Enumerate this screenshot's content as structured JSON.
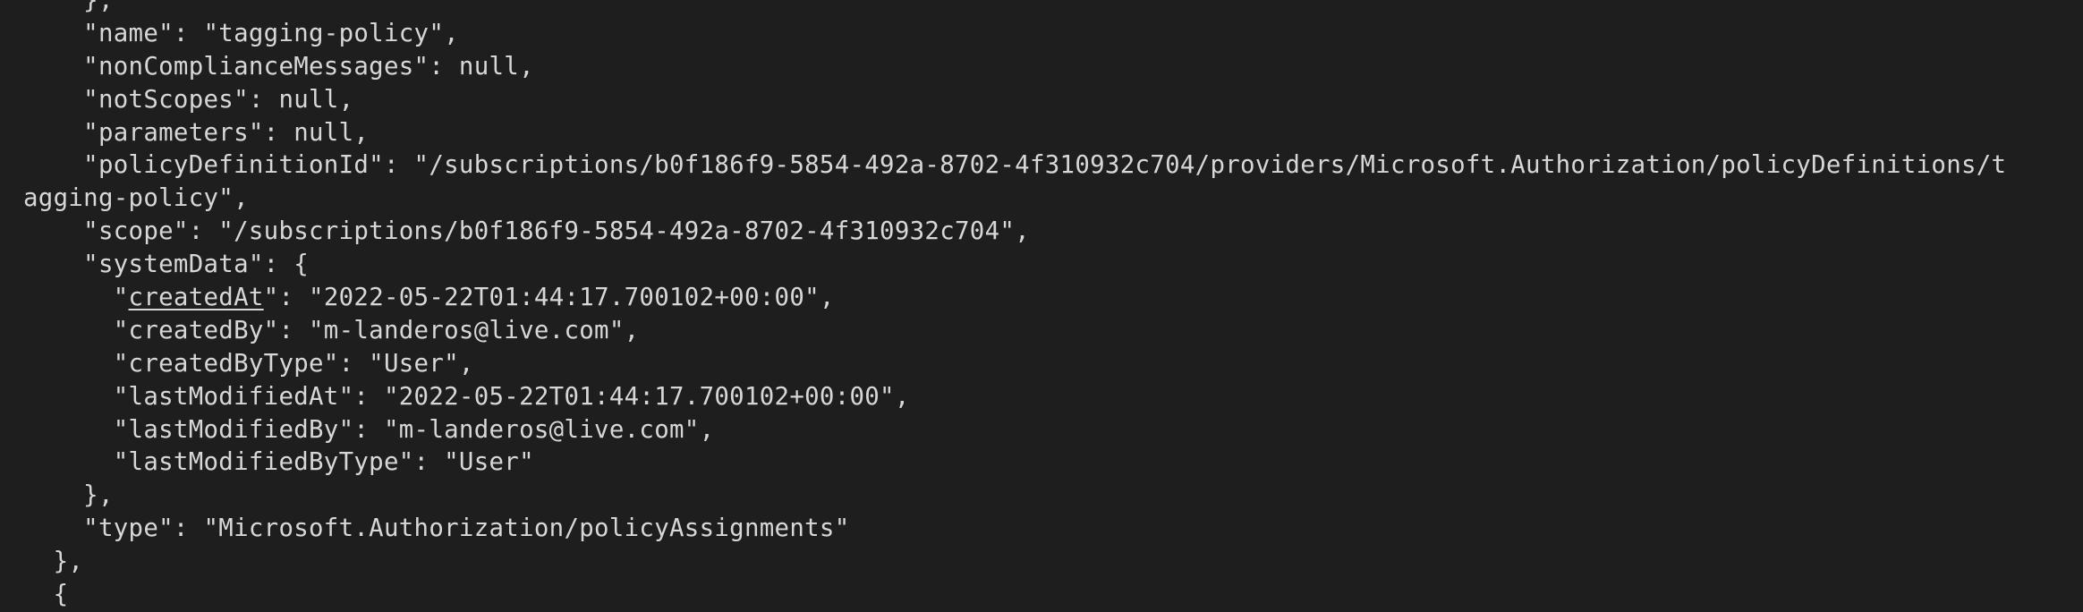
{
  "terminal": {
    "lines": [
      "    },",
      "    \"name\": \"tagging-policy\",",
      "    \"nonComplianceMessages\": null,",
      "    \"notScopes\": null,",
      "    \"parameters\": null,",
      "    \"policyDefinitionId\": \"/subscriptions/b0f186f9-5854-492a-8702-4f310932c704/providers/Microsoft.Authorization/policyDefinitions/t",
      "agging-policy\",",
      "    \"scope\": \"/subscriptions/b0f186f9-5854-492a-8702-4f310932c704\",",
      "    \"systemData\": {",
      "      \"",
      "createdAt",
      "\": \"2022-05-22T01:44:17.700102+00:00\",",
      "      \"createdBy\": \"m-landeros@live.com\",",
      "      \"createdByType\": \"User\",",
      "      \"lastModifiedAt\": \"2022-05-22T01:44:17.700102+00:00\",",
      "      \"lastModifiedBy\": \"m-landeros@live.com\",",
      "      \"lastModifiedByType\": \"User\"",
      "    },",
      "    \"type\": \"Microsoft.Authorization/policyAssignments\"",
      "  },",
      "  {"
    ]
  }
}
